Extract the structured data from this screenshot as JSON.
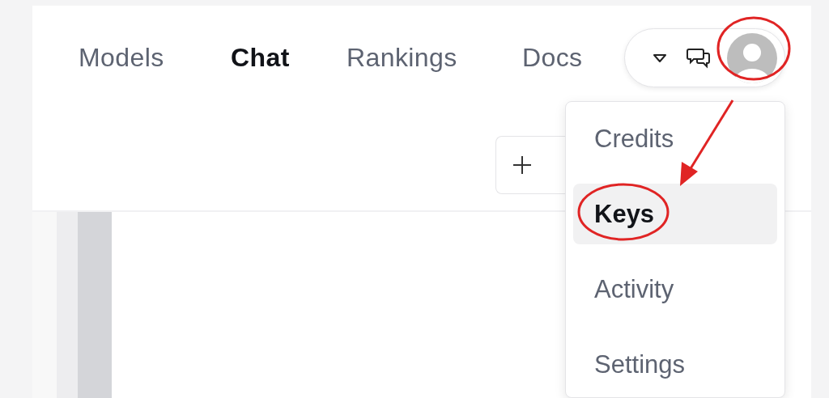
{
  "nav": {
    "links": [
      {
        "label": "Models",
        "selected": false
      },
      {
        "label": "Chat",
        "selected": true
      },
      {
        "label": "Rankings",
        "selected": false
      },
      {
        "label": "Docs",
        "selected": false
      }
    ]
  },
  "menu": {
    "items": [
      {
        "label": "Credits",
        "selected": false
      },
      {
        "label": "Keys",
        "selected": true
      },
      {
        "label": "Activity",
        "selected": false
      },
      {
        "label": "Settings",
        "selected": false
      }
    ]
  },
  "annotation": {
    "avatar_circled": true,
    "item_circled": true,
    "arrow": true
  }
}
